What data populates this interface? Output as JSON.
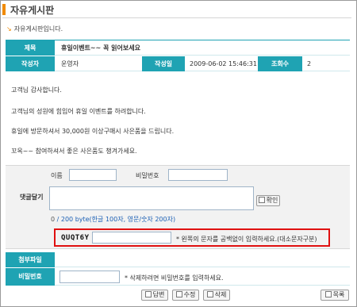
{
  "page": {
    "title": "자유게시판",
    "description": "자유게시판입니다."
  },
  "post": {
    "subject_label": "제목",
    "subject": "휴일이벤트~~ 꼭 읽어보세요",
    "author_label": "작성자",
    "author": "운영자",
    "date_label": "작성일",
    "date": "2009-06-02 15:46:31",
    "views_label": "조회수",
    "views": "2",
    "body": [
      "고객님 감사합니다.",
      "고객님의 성원에 힘입어 휴일 이벤트를 하려합니다.",
      "휴일에 방문하셔서 30,000원 이상구매시 사은품을 드립니다.",
      "꼬옥~~ 참여하셔서 좋은 사은품도 챙겨가세요."
    ]
  },
  "comment": {
    "section_label": "댓글달기",
    "name_label": "이름",
    "password_label": "비밀번호",
    "submit_label": "확인",
    "counter_current": "0",
    "counter_rest": " / 200 byte(한글 100자, 영문/숫자 200자)",
    "captcha_code": "QUQT6Y",
    "captcha_hint": "* 왼쪽의 문자를 공백없이 입력하세요.(대소문자구분)"
  },
  "attachment": {
    "label": "첨부파일"
  },
  "delete_password": {
    "label": "비밀번호",
    "hint": "* 삭제하려면 비밀번호를 입력하세요."
  },
  "actions": {
    "reply": "답변",
    "edit": "수정",
    "delete": "삭제",
    "list": "목록"
  },
  "colors": {
    "header_teal": "#1fa3b3",
    "accent_orange": "#f08a00",
    "captcha_border": "#e01010"
  }
}
